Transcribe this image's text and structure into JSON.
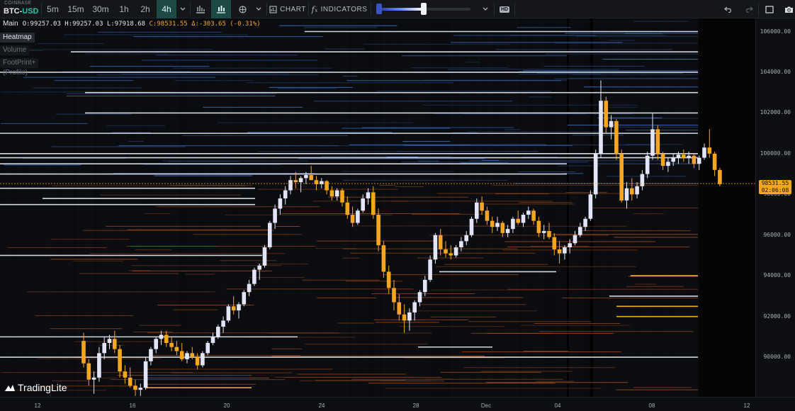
{
  "symbol": {
    "exchange": "COINBASE",
    "base": "BTC",
    "separator": "-",
    "quote": "USD"
  },
  "timeframes": [
    {
      "label": "5m",
      "active": false
    },
    {
      "label": "15m",
      "active": false
    },
    {
      "label": "30m",
      "active": false
    },
    {
      "label": "1h",
      "active": false
    },
    {
      "label": "2h",
      "active": false
    },
    {
      "label": "4h",
      "active": true
    }
  ],
  "toolbar": {
    "chart_label": "CHART",
    "indicators_label": "INDICATORS",
    "hd_label": "HD",
    "heatmap_range": {
      "low": 0.0,
      "high": 0.48
    }
  },
  "legend": {
    "main_label": "Main",
    "open": "O:99257.03",
    "high": "H:99257.03",
    "low": "L:97918.68",
    "close": "C:98531.55",
    "change": "Δ:-303.65 (-0.31%)",
    "layers": [
      "Heatmap",
      "Volume",
      "FootPrint+ (Profile)"
    ]
  },
  "price_tag": {
    "price": "98531.55",
    "countdown": "02:06:08",
    "color": "#f3a71f"
  },
  "brand": {
    "name": "TradingLite"
  },
  "colors": {
    "up": "#e2e4f7",
    "down": "#f5a61f",
    "accent": "#26c2a9",
    "liquidity_blue": "#3d7bd9",
    "liquidity_orange": "#e0702b"
  },
  "chart_data": {
    "type": "candlestick",
    "interval": "4h",
    "y_axis": {
      "ticks": [
        106000,
        104000,
        102000,
        100000,
        98000,
        96000,
        94000,
        92000,
        90000
      ]
    },
    "x_axis": {
      "ticks": [
        "12",
        "16",
        "20",
        "24",
        "28",
        "Dec",
        "04",
        "08",
        "12"
      ]
    },
    "ylim": [
      88000,
      106500
    ],
    "last_price": 98531.55,
    "candles": [
      [
        90800,
        91200,
        89500,
        89700
      ],
      [
        89700,
        89900,
        88600,
        88900
      ],
      [
        88900,
        89300,
        88200,
        89000
      ],
      [
        89000,
        90500,
        88800,
        90200
      ],
      [
        90200,
        91000,
        89900,
        90700
      ],
      [
        90700,
        91100,
        90400,
        90900
      ],
      [
        90900,
        91300,
        90200,
        90400
      ],
      [
        90400,
        90600,
        89000,
        89300
      ],
      [
        89300,
        89600,
        88700,
        89000
      ],
      [
        89000,
        89500,
        88500,
        88600
      ],
      [
        88600,
        88900,
        88100,
        88400
      ],
      [
        88400,
        88700,
        88100,
        88500
      ],
      [
        88500,
        90000,
        88400,
        89800
      ],
      [
        89800,
        90500,
        89600,
        90400
      ],
      [
        90400,
        91000,
        90200,
        90900
      ],
      [
        90900,
        91300,
        90600,
        91100
      ],
      [
        91100,
        91300,
        90500,
        90700
      ],
      [
        90700,
        91000,
        90300,
        90500
      ],
      [
        90500,
        90800,
        90100,
        90300
      ],
      [
        90300,
        90700,
        89800,
        89900
      ],
      [
        89900,
        90300,
        89700,
        90200
      ],
      [
        90200,
        90500,
        89900,
        90000
      ],
      [
        90000,
        90200,
        89400,
        89600
      ],
      [
        89600,
        90300,
        89500,
        90200
      ],
      [
        90200,
        90800,
        90100,
        90700
      ],
      [
        90700,
        91200,
        90600,
        91000
      ],
      [
        91000,
        91600,
        90900,
        91500
      ],
      [
        91500,
        92000,
        91200,
        91800
      ],
      [
        91800,
        92600,
        91700,
        92500
      ],
      [
        92500,
        93000,
        92100,
        92300
      ],
      [
        92300,
        92700,
        91900,
        92600
      ],
      [
        92600,
        93300,
        92500,
        93200
      ],
      [
        93200,
        93800,
        93000,
        93600
      ],
      [
        93600,
        94400,
        93500,
        94300
      ],
      [
        94300,
        94600,
        93800,
        94500
      ],
      [
        94500,
        95500,
        94400,
        95400
      ],
      [
        95400,
        96700,
        95300,
        96600
      ],
      [
        96600,
        97500,
        96300,
        97300
      ],
      [
        97300,
        98000,
        97000,
        97800
      ],
      [
        97800,
        98400,
        97500,
        98200
      ],
      [
        98200,
        98900,
        98000,
        98700
      ],
      [
        98700,
        99100,
        98300,
        98600
      ],
      [
        98600,
        98900,
        98100,
        98800
      ],
      [
        98800,
        99100,
        98500,
        98950
      ],
      [
        98950,
        99400,
        98700,
        98700
      ],
      [
        98700,
        98900,
        98200,
        98500
      ],
      [
        98500,
        98800,
        98300,
        98650
      ],
      [
        98650,
        98700,
        98000,
        98200
      ],
      [
        98200,
        98400,
        97700,
        97900
      ],
      [
        97900,
        98300,
        97700,
        98200
      ],
      [
        98200,
        98300,
        97400,
        97600
      ],
      [
        97600,
        97900,
        96800,
        97000
      ],
      [
        97000,
        97400,
        96400,
        96600
      ],
      [
        96600,
        97300,
        96500,
        97200
      ],
      [
        97200,
        98000,
        97100,
        97800
      ],
      [
        97800,
        98300,
        97500,
        98100
      ],
      [
        98100,
        98400,
        96800,
        97000
      ],
      [
        97000,
        97300,
        95200,
        95500
      ],
      [
        95500,
        95700,
        93900,
        94200
      ],
      [
        94200,
        94500,
        93100,
        93400
      ],
      [
        93400,
        93800,
        92300,
        92700
      ],
      [
        92700,
        93100,
        91800,
        92100
      ],
      [
        92100,
        92600,
        91200,
        91800
      ],
      [
        91800,
        92400,
        91300,
        92200
      ],
      [
        92200,
        92800,
        91800,
        92700
      ],
      [
        92700,
        93300,
        92500,
        93200
      ],
      [
        93200,
        94000,
        93000,
        93800
      ],
      [
        93800,
        95000,
        93700,
        94800
      ],
      [
        94800,
        96100,
        94600,
        96000
      ],
      [
        96000,
        96300,
        95000,
        95300
      ],
      [
        95300,
        95700,
        94900,
        95100
      ],
      [
        95100,
        95500,
        94800,
        95000
      ],
      [
        95000,
        95500,
        94900,
        95400
      ],
      [
        95400,
        95900,
        95200,
        95700
      ],
      [
        95700,
        96200,
        95500,
        96000
      ],
      [
        96000,
        96900,
        95900,
        96800
      ],
      [
        96800,
        97800,
        96600,
        97600
      ],
      [
        97600,
        97900,
        97000,
        97200
      ],
      [
        97200,
        97400,
        96500,
        96700
      ],
      [
        96700,
        96900,
        96100,
        96400
      ],
      [
        96400,
        96900,
        96200,
        96600
      ],
      [
        96600,
        96700,
        95900,
        96100
      ],
      [
        96100,
        96500,
        95900,
        96300
      ],
      [
        96300,
        96900,
        96100,
        96800
      ],
      [
        96800,
        97200,
        96500,
        96600
      ],
      [
        96600,
        97100,
        96400,
        97000
      ],
      [
        97000,
        97400,
        96800,
        97200
      ],
      [
        97200,
        97300,
        96500,
        96700
      ],
      [
        96700,
        96900,
        95900,
        96100
      ],
      [
        96100,
        96500,
        95800,
        96200
      ],
      [
        96200,
        96600,
        95800,
        95900
      ],
      [
        95900,
        96100,
        95000,
        95300
      ],
      [
        95300,
        95700,
        94600,
        95100
      ],
      [
        95100,
        95500,
        94800,
        95400
      ],
      [
        95400,
        95800,
        95100,
        95600
      ],
      [
        95600,
        96200,
        95500,
        96000
      ],
      [
        96000,
        96600,
        95900,
        96400
      ],
      [
        96400,
        96900,
        96200,
        96800
      ],
      [
        96800,
        98200,
        96700,
        98000
      ],
      [
        98000,
        100200,
        97800,
        100000
      ],
      [
        100000,
        103600,
        99800,
        102600
      ],
      [
        102600,
        102800,
        101000,
        101300
      ],
      [
        101300,
        101900,
        100700,
        101600
      ],
      [
        101600,
        101700,
        99700,
        100000
      ],
      [
        100000,
        100200,
        97600,
        97700
      ],
      [
        97700,
        98600,
        97300,
        98300
      ],
      [
        98300,
        98800,
        97700,
        98000
      ],
      [
        98000,
        98600,
        97800,
        98400
      ],
      [
        98400,
        99200,
        98200,
        99000
      ],
      [
        99000,
        100100,
        98800,
        99900
      ],
      [
        99900,
        102000,
        99700,
        101200
      ],
      [
        101200,
        101400,
        99700,
        100000
      ],
      [
        100000,
        100100,
        99200,
        99400
      ],
      [
        99400,
        99800,
        99100,
        99600
      ],
      [
        99600,
        100000,
        99400,
        99800
      ],
      [
        99800,
        100100,
        99500,
        99950
      ],
      [
        99950,
        100200,
        99600,
        99800
      ],
      [
        99800,
        100100,
        99500,
        99900
      ],
      [
        99900,
        100000,
        99300,
        99500
      ],
      [
        99500,
        99900,
        99200,
        99800
      ],
      [
        99800,
        100500,
        99700,
        100300
      ],
      [
        100300,
        101200,
        99800,
        100000
      ],
      [
        100000,
        100100,
        98900,
        99200
      ],
      [
        99200,
        99300,
        98400,
        98500
      ]
    ]
  }
}
